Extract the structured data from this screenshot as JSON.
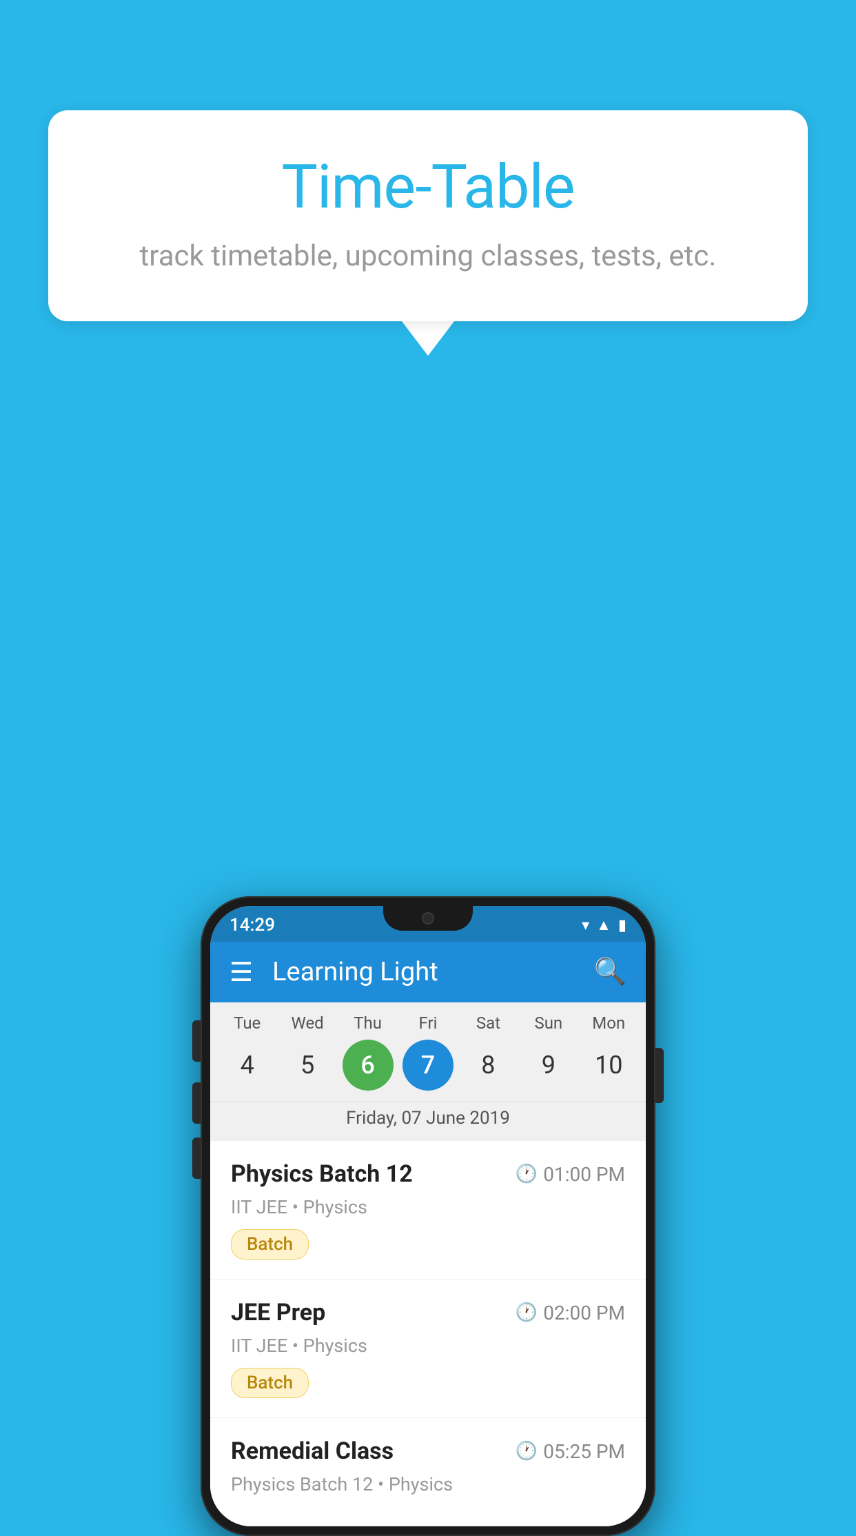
{
  "background_color": "#29b6e8",
  "speech_bubble": {
    "title": "Time-Table",
    "subtitle": "track timetable, upcoming classes, tests, etc."
  },
  "phone": {
    "status_bar": {
      "time": "14:29"
    },
    "app_bar": {
      "title": "Learning Light"
    },
    "calendar": {
      "days": [
        {
          "label": "Tue",
          "num": "4",
          "state": "normal"
        },
        {
          "label": "Wed",
          "num": "5",
          "state": "normal"
        },
        {
          "label": "Thu",
          "num": "6",
          "state": "today"
        },
        {
          "label": "Fri",
          "num": "7",
          "state": "selected"
        },
        {
          "label": "Sat",
          "num": "8",
          "state": "normal"
        },
        {
          "label": "Sun",
          "num": "9",
          "state": "normal"
        },
        {
          "label": "Mon",
          "num": "10",
          "state": "normal"
        }
      ],
      "selected_date": "Friday, 07 June 2019"
    },
    "schedule": [
      {
        "title": "Physics Batch 12",
        "time": "01:00 PM",
        "subtitle": "IIT JEE • Physics",
        "badge": "Batch"
      },
      {
        "title": "JEE Prep",
        "time": "02:00 PM",
        "subtitle": "IIT JEE • Physics",
        "badge": "Batch"
      },
      {
        "title": "Remedial Class",
        "time": "05:25 PM",
        "subtitle": "Physics Batch 12 • Physics",
        "badge": null
      }
    ]
  }
}
